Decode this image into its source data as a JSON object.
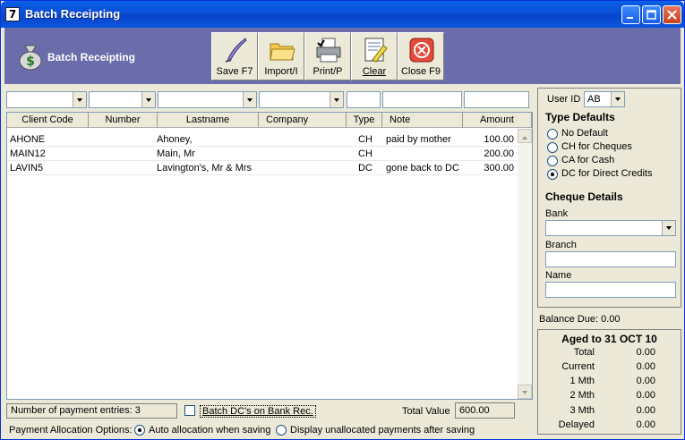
{
  "window": {
    "icon_label": "7",
    "title": "Batch Receipting"
  },
  "header": {
    "title": "Batch Receipting"
  },
  "toolbar": [
    {
      "label": "Save F7",
      "icon": "quill-icon"
    },
    {
      "label": "Import/I",
      "icon": "folder-icon"
    },
    {
      "label": "Print/P",
      "icon": "printer-icon"
    },
    {
      "label": "Clear",
      "icon": "clear-icon"
    },
    {
      "label": "Close F9",
      "icon": "close-circle-icon"
    }
  ],
  "grid": {
    "columns": [
      "Client Code",
      "Number",
      "Lastname",
      "Company",
      "Type",
      "Note",
      "Amount"
    ],
    "rows": [
      {
        "client_code": "AHONE",
        "number": "",
        "lastname": "Ahoney,",
        "company": "",
        "type": "CH",
        "note": "paid by mother",
        "amount": "100.00"
      },
      {
        "client_code": "MAIN12",
        "number": "",
        "lastname": "Main, Mr",
        "company": "",
        "type": "CH",
        "note": "",
        "amount": "200.00"
      },
      {
        "client_code": "LAVIN5",
        "number": "",
        "lastname": "Lavington's, Mr & Mrs",
        "company": "",
        "type": "DC",
        "note": "gone back to DC",
        "amount": "300.00"
      }
    ]
  },
  "footer": {
    "entries_text": "Number of payment entries: 3",
    "batch_dc_label": "Batch DC's on Bank Rec.",
    "total_value_label": "Total Value",
    "total_value": "600.00",
    "allocation_label": "Payment Allocation Options:",
    "alloc_auto": "Auto allocation when saving",
    "alloc_display": "Display unallocated payments after saving"
  },
  "panel": {
    "user_id_label": "User ID",
    "user_id_value": "AB",
    "type_defaults_title": "Type Defaults",
    "type_options": [
      "No Default",
      "CH for Cheques",
      "CA for Cash",
      "DC for Direct Credits"
    ],
    "selected_type": "DC for Direct Credits",
    "cheque_title": "Cheque Details",
    "bank_label": "Bank",
    "branch_label": "Branch",
    "name_label": "Name"
  },
  "balance_due": "Balance Due:  0.00",
  "aged": {
    "title": "Aged to 31 OCT 10",
    "rows": [
      {
        "label": "Total",
        "value": "0.00"
      },
      {
        "label": "Current",
        "value": "0.00"
      },
      {
        "label": "1 Mth",
        "value": "0.00"
      },
      {
        "label": "2 Mth",
        "value": "0.00"
      },
      {
        "label": "3 Mth",
        "value": "0.00"
      },
      {
        "label": "Delayed",
        "value": "0.00"
      }
    ]
  }
}
